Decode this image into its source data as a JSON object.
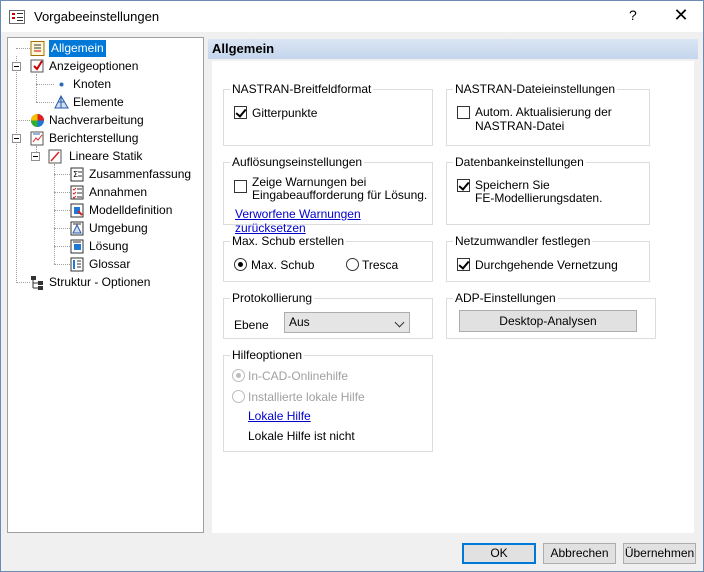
{
  "window": {
    "title": "Vorgabeeinstellungen",
    "help": "?",
    "close": "✕"
  },
  "tree": {
    "allgemein": "Allgemein",
    "anzeigeoptionen": "Anzeigeoptionen",
    "knoten": "Knoten",
    "elemente": "Elemente",
    "nachverarbeitung": "Nachverarbeitung",
    "berichterstellung": "Berichterstellung",
    "lineare_statik": "Lineare Statik",
    "zusammenfassung": "Zusammenfassung",
    "annahmen": "Annahmen",
    "modelldefinition": "Modelldefinition",
    "umgebung": "Umgebung",
    "loesung": "Lösung",
    "glossar": "Glossar",
    "struktur": "Struktur - Optionen"
  },
  "panel": {
    "header": "Allgemein"
  },
  "nastran_breitfeld": {
    "title": "NASTRAN-Breitfeldformat",
    "gitterpunkte": "Gitterpunkte"
  },
  "nastran_datei": {
    "title": "NASTRAN-Dateieinstellungen",
    "auto_line1": "Autom. Aktualisierung der",
    "auto_line2": "NASTRAN-Datei"
  },
  "aufloesung": {
    "title": "Auflösungseinstellungen",
    "warn_line1": "Zeige Warnungen bei",
    "warn_line2": "Eingabeaufforderung für Lösung.",
    "reset_link": "Verworfene Warnungen zurücksetzen"
  },
  "datenbank": {
    "title": "Datenbankeinstellungen",
    "save_line1": "Speichern Sie",
    "save_line2": "FE-Modellierungsdaten."
  },
  "max_schub": {
    "title": "Max. Schub erstellen",
    "option1": "Max. Schub",
    "option2": "Tresca"
  },
  "netzumwandler": {
    "title": "Netzumwandler festlegen",
    "durchgehend": "Durchgehende Vernetzung"
  },
  "protokoll": {
    "title": "Protokollierung",
    "ebene_label": "Ebene",
    "ebene_value": "Aus"
  },
  "adp": {
    "title": "ADP-Einstellungen",
    "button": "Desktop-Analysen"
  },
  "hilfe": {
    "title": "Hilfeoptionen",
    "option1": "In-CAD-Onlinehilfe",
    "option2": "Installierte lokale Hilfe",
    "link": "Lokale Hilfe",
    "status": "Lokale Hilfe ist nicht"
  },
  "footer": {
    "ok": "OK",
    "cancel": "Abbrechen",
    "apply": "Übernehmen"
  },
  "colors": {
    "selection": "#0078d7",
    "link": "#0000cc",
    "header_gradient": "#c4d5ec"
  }
}
